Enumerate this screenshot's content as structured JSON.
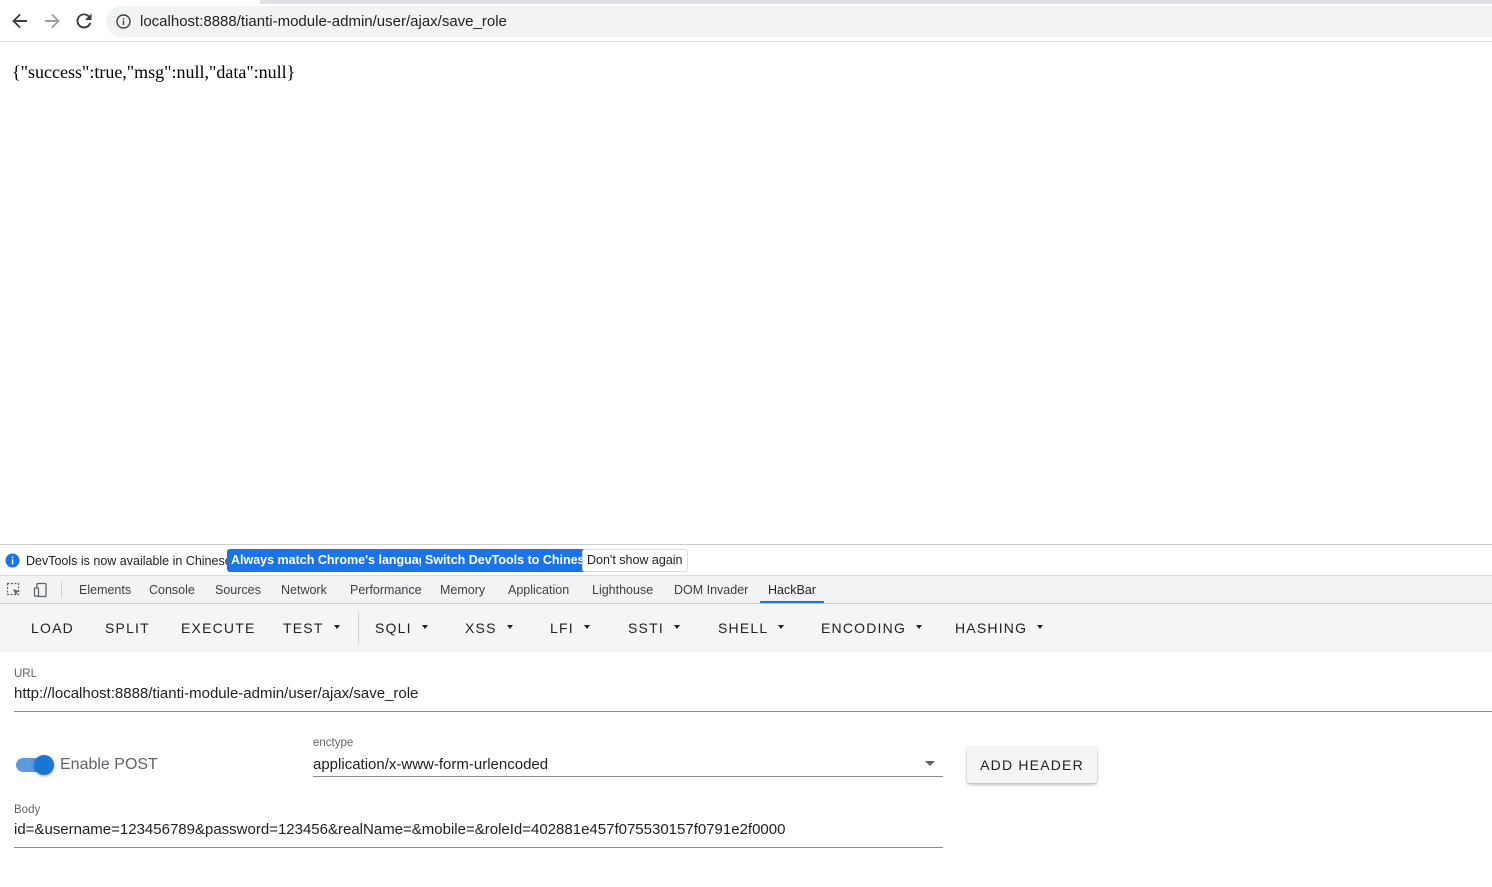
{
  "browser": {
    "address_url": "localhost:8888/tianti-module-admin/user/ajax/save_role",
    "nav_icons": [
      "back-arrow-icon",
      "forward-arrow-icon",
      "reload-icon",
      "site-info-icon"
    ]
  },
  "page": {
    "json_response": "{\"success\":true,\"msg\":null,\"data\":null}"
  },
  "devtools": {
    "infobar": {
      "message": "DevTools is now available in Chinese!",
      "btn_match_language": "Always match Chrome's language",
      "btn_switch_chinese": "Switch DevTools to Chinese",
      "btn_dont_show": "Don't show again"
    },
    "tabs": [
      "Elements",
      "Console",
      "Sources",
      "Network",
      "Performance",
      "Memory",
      "Application",
      "Lighthouse",
      "DOM Invader",
      "HackBar"
    ],
    "active_tab": "HackBar",
    "accent_color": "#1a73e8"
  },
  "hackbar": {
    "toolbar": {
      "load": "LOAD",
      "split": "SPLIT",
      "execute": "EXECUTE",
      "test": "TEST",
      "sqli": "SQLI",
      "xss": "XSS",
      "lfi": "LFI",
      "ssti": "SSTI",
      "shell": "SHELL",
      "encoding": "ENCODING",
      "hashing": "HASHING"
    },
    "url_label": "URL",
    "url_value": "http://localhost:8888/tianti-module-admin/user/ajax/save_role",
    "enable_post_label": "Enable POST",
    "enable_post_on": true,
    "enctype_label": "enctype",
    "enctype_value": "application/x-www-form-urlencoded",
    "add_header_label": "ADD HEADER",
    "body_label": "Body",
    "body_value": "id=&username=123456789&password=123456&realName=&mobile=&roleId=402881e457f075530157f0791e2f0000"
  }
}
